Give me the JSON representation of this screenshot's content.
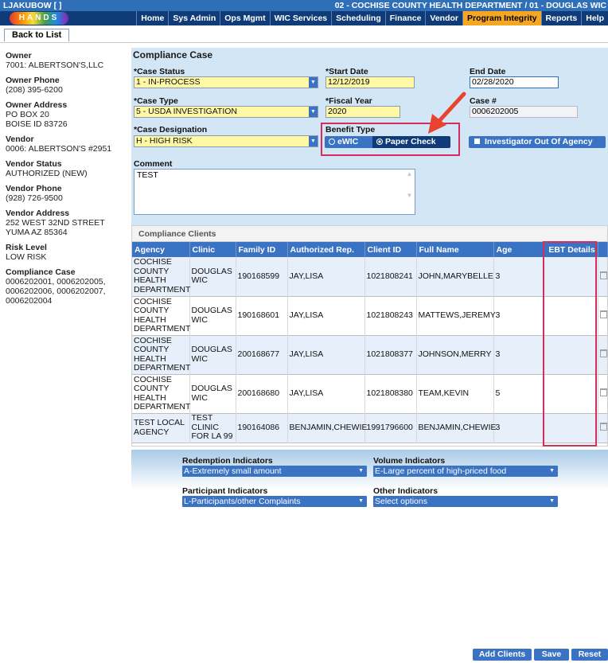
{
  "topbar": {
    "user": "LJAKUBOW [",
    "user_link": "   ",
    "user_end": "]",
    "department": "02 - COCHISE COUNTY HEALTH DEPARTMENT / 01 - DOUGLAS WIC"
  },
  "logo": {
    "text": "HANDS",
    "icon": "hands-logo-icon"
  },
  "nav": [
    "Home",
    "Sys Admin",
    "Ops Mgmt",
    "WIC Services",
    "Scheduling",
    "Finance",
    "Vendor",
    "Program Integrity",
    "Reports",
    "Help"
  ],
  "nav_active": "Program Integrity",
  "back_button": "Back to List",
  "left_panel": [
    {
      "label": "Owner",
      "value": "7001: ALBERTSON'S,LLC"
    },
    {
      "label": "Owner Phone",
      "value": "(208) 395-6200"
    },
    {
      "label": "Owner Address",
      "value": "PO BOX 20\nBOISE ID 83726"
    },
    {
      "label": "Vendor",
      "value": "0006: ALBERTSON'S #2951"
    },
    {
      "label": "Vendor Status",
      "value": "AUTHORIZED (NEW)"
    },
    {
      "label": "Vendor Phone",
      "value": "(928) 726-9500"
    },
    {
      "label": "Vendor Address",
      "value": "252 WEST 32ND STREET\nYUMA AZ 85364"
    },
    {
      "label": "Risk Level",
      "value": "LOW RISK"
    },
    {
      "label": "Compliance Case",
      "value": "0006202001, 0006202005,\n0006202006, 0006202007,\n0006202004"
    }
  ],
  "case": {
    "title": "Compliance Case",
    "case_status_label": "*Case Status",
    "case_status": "1 - IN-PROCESS",
    "start_date_label": "*Start Date",
    "start_date": "12/12/2019",
    "end_date_label": "End Date",
    "end_date": "02/28/2020",
    "case_type_label": "*Case Type",
    "case_type": "5 - USDA INVESTIGATION",
    "fiscal_year_label": "*Fiscal Year",
    "fiscal_year": "2020",
    "case_num_label": "Case #",
    "case_num": "0006202005",
    "designation_label": "*Case Designation",
    "designation": "H - HIGH RISK",
    "benefit_type_label": "Benefit Type",
    "benefit_options": [
      "eWIC",
      "Paper Check"
    ],
    "benefit_selected": "Paper Check",
    "ioa_label": "Investigator Out Of Agency",
    "comment_label": "Comment",
    "comment": "TEST"
  },
  "clients": {
    "title": "Compliance Clients",
    "columns": [
      "Agency",
      "Clinic",
      "Family ID",
      "Authorized Rep.",
      "Client ID",
      "Full Name",
      "Age",
      "EBT Details"
    ],
    "rows": [
      {
        "agency": "COCHISE COUNTY HEALTH DEPARTMENT",
        "clinic": "DOUGLAS WIC",
        "family_id": "190168599",
        "rep": "JAY,LISA",
        "client_id": "1021808241",
        "name": "JOHN,MARYBELLE",
        "age": "3",
        "ebt": ""
      },
      {
        "agency": "COCHISE COUNTY HEALTH DEPARTMENT",
        "clinic": "DOUGLAS WIC",
        "family_id": "190168601",
        "rep": "JAY,LISA",
        "client_id": "1021808243",
        "name": "MATTEWS,JEREMY",
        "age": "3",
        "ebt": ""
      },
      {
        "agency": "COCHISE COUNTY HEALTH DEPARTMENT",
        "clinic": "DOUGLAS WIC",
        "family_id": "200168677",
        "rep": "JAY,LISA",
        "client_id": "1021808377",
        "name": "JOHNSON,MERRY",
        "age": "3",
        "ebt": ""
      },
      {
        "agency": "COCHISE COUNTY HEALTH DEPARTMENT",
        "clinic": "DOUGLAS WIC",
        "family_id": "200168680",
        "rep": "JAY,LISA",
        "client_id": "1021808380",
        "name": "TEAM,KEVIN",
        "age": "5",
        "ebt": ""
      },
      {
        "agency": "TEST LOCAL AGENCY",
        "clinic": "TEST CLINIC FOR LA 99",
        "family_id": "190164086",
        "rep": "BENJAMIN,CHEWIE",
        "client_id": "1991796600",
        "name": "BENJAMIN,CHEWIE",
        "age": "3",
        "ebt": ""
      }
    ]
  },
  "indicators": {
    "redemption_label": "Redemption Indicators",
    "redemption": "A-Extremely small amount",
    "volume_label": "Volume Indicators",
    "volume": "E-Large percent of high-priced food",
    "participant_label": "Participant Indicators",
    "participant": "L-Participants/other Complaints",
    "other_label": "Other Indicators",
    "other": "Select options"
  },
  "footer": {
    "add_clients": "Add Clients",
    "save": "Save",
    "reset": "Reset"
  },
  "colors": {
    "nav_bg": "#0f3c78",
    "accent": "#3a72c4",
    "active_tab": "#f5a623",
    "required_field": "#fff9a6",
    "highlight_box": "#d52d5c",
    "annotation_arrow": "#e8432f"
  }
}
